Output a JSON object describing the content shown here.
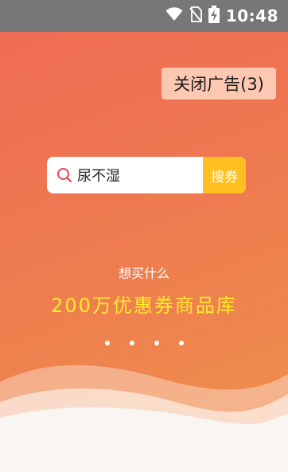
{
  "status_bar": {
    "time": "10:48",
    "icons": [
      "wifi-icon",
      "no-sim-icon",
      "battery-charging-icon"
    ]
  },
  "ad": {
    "close_label": "关闭广告(3)"
  },
  "search": {
    "query": "尿不湿",
    "button_label": "搜券",
    "icon": "search-icon"
  },
  "promo": {
    "subtitle": "想买什么",
    "headline": "200万优惠券商品库"
  },
  "pager": {
    "dot_count": 4
  },
  "colors": {
    "gradient_start": "#f06a56",
    "gradient_end": "#ee914a",
    "search_button": "#ffbf1f",
    "headline": "#ffeb2a",
    "search_icon": "#e8455a"
  }
}
